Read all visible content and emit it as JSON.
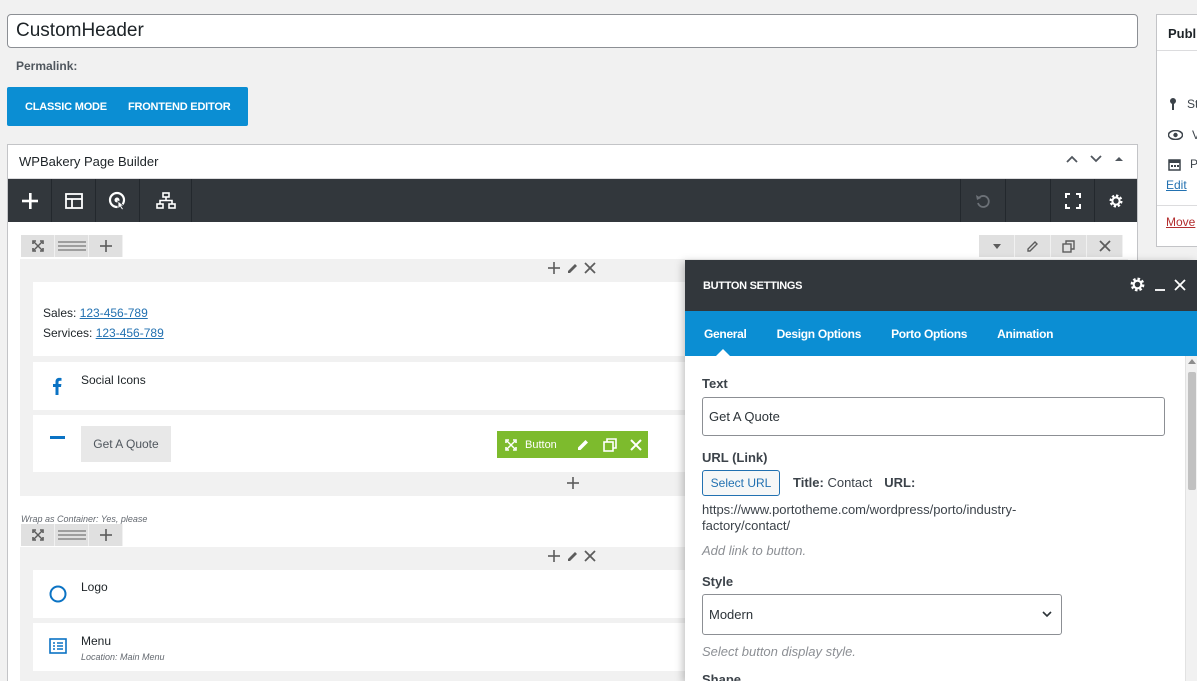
{
  "post": {
    "title": "CustomHeader",
    "permalink_label": "Permalink:"
  },
  "modes": {
    "classic": "CLASSIC MODE",
    "frontend": "FRONTEND EDITOR"
  },
  "publish": {
    "title": "Publi",
    "rows": [
      "St",
      "V",
      "Pi"
    ],
    "edit": "Edit",
    "move": "Move"
  },
  "builder": {
    "title": "WPBakery Page Builder"
  },
  "elements": {
    "contact": {
      "sales_label": "Sales: ",
      "sales_phone": "123-456-789",
      "services_label": "Services: ",
      "services_phone": "123-456-789"
    },
    "social": "Social Icons",
    "button_label": "Get A Quote",
    "row2_note": "Wrap as Container: Yes, please",
    "logo": "Logo",
    "menu": "Menu",
    "menu_sub": "Location: Main Menu"
  },
  "green_ctrl": {
    "label": "Button"
  },
  "modal": {
    "title": "BUTTON SETTINGS",
    "tabs": [
      "General",
      "Design Options",
      "Porto Options",
      "Animation"
    ],
    "active_tab": "General",
    "fields": {
      "text_label": "Text",
      "text_value": "Get A Quote",
      "url_label": "URL (Link)",
      "select_url": "Select URL",
      "title_key": "Title:",
      "title_value": "Contact",
      "url_key": "URL:",
      "url_value": "https://www.portotheme.com/wordpress/porto/industry-factory/contact/",
      "url_help": "Add link to button.",
      "style_label": "Style",
      "style_value": "Modern",
      "style_help": "Select button display style.",
      "next_label": "Shape"
    }
  },
  "colors": {
    "accent": "#0b8ed3",
    "toolbar": "#32373c",
    "green": "#7dbb2d"
  }
}
